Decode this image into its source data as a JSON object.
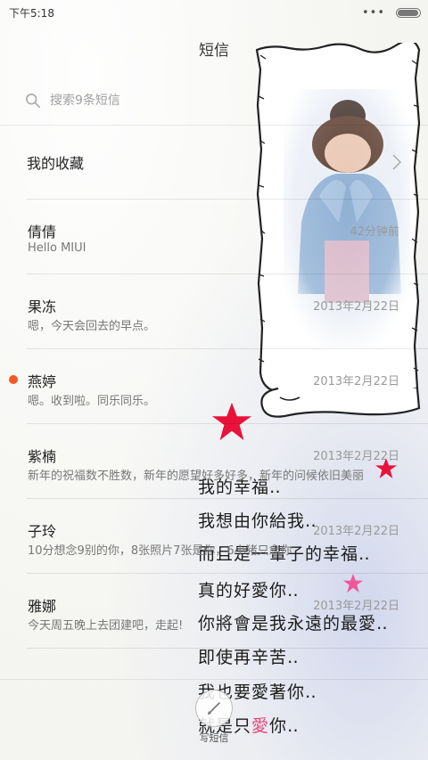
{
  "status_bar": {
    "time": "下午5:18",
    "more_icon": "more-dots-icon",
    "battery_icon": "battery-icon",
    "battery_level": 0.9
  },
  "header": {
    "title": "短信"
  },
  "search": {
    "placeholder": "搜索9条短信",
    "icon": "search-icon"
  },
  "favorites": {
    "label": "我的收藏",
    "icon": "chevron-right-icon"
  },
  "messages": [
    {
      "name": "倩倩",
      "preview": "Hello MIUI",
      "time": "42分钟前",
      "unread": false
    },
    {
      "name": "果冻",
      "preview": "嗯，今天会回去的早点。",
      "time": "2013年2月22日",
      "unread": false
    },
    {
      "name": "燕婷",
      "preview": "嗯。收到啦。同乐同乐。",
      "time": "2013年2月22日",
      "unread": true
    },
    {
      "name": "紫楠",
      "preview": "新年的祝福数不胜数，新年的愿望好多好多，新年的问候依旧美丽",
      "time": "2013年2月22日",
      "unread": false
    },
    {
      "name": "子玲",
      "preview": "10分想念9别的你，8张照片7张是你，6小猪只念你",
      "time": "2013年2月22日",
      "unread": false
    },
    {
      "name": "雅娜",
      "preview": "今天周五晚上去团建吧，走起!",
      "time": "2013年2月22日",
      "unread": false
    }
  ],
  "compose": {
    "label": "写短信",
    "icon": "compose-pen-icon"
  },
  "wallpaper_text": [
    "我的幸福‥",
    "我想由你給我‥",
    "而且是一輩子的幸福‥",
    "真的好愛你‥",
    "你將會是我永遠的最愛‥",
    "即使再辛苦‥",
    "我也要愛著你‥",
    "就是只"
  ],
  "wallpaper_text_last_heart": "愛",
  "wallpaper_text_last_tail": "你‥",
  "colors": {
    "unread_dot": "#f15a23",
    "star_red": "#e8123a",
    "star_pink": "#f0569a"
  }
}
